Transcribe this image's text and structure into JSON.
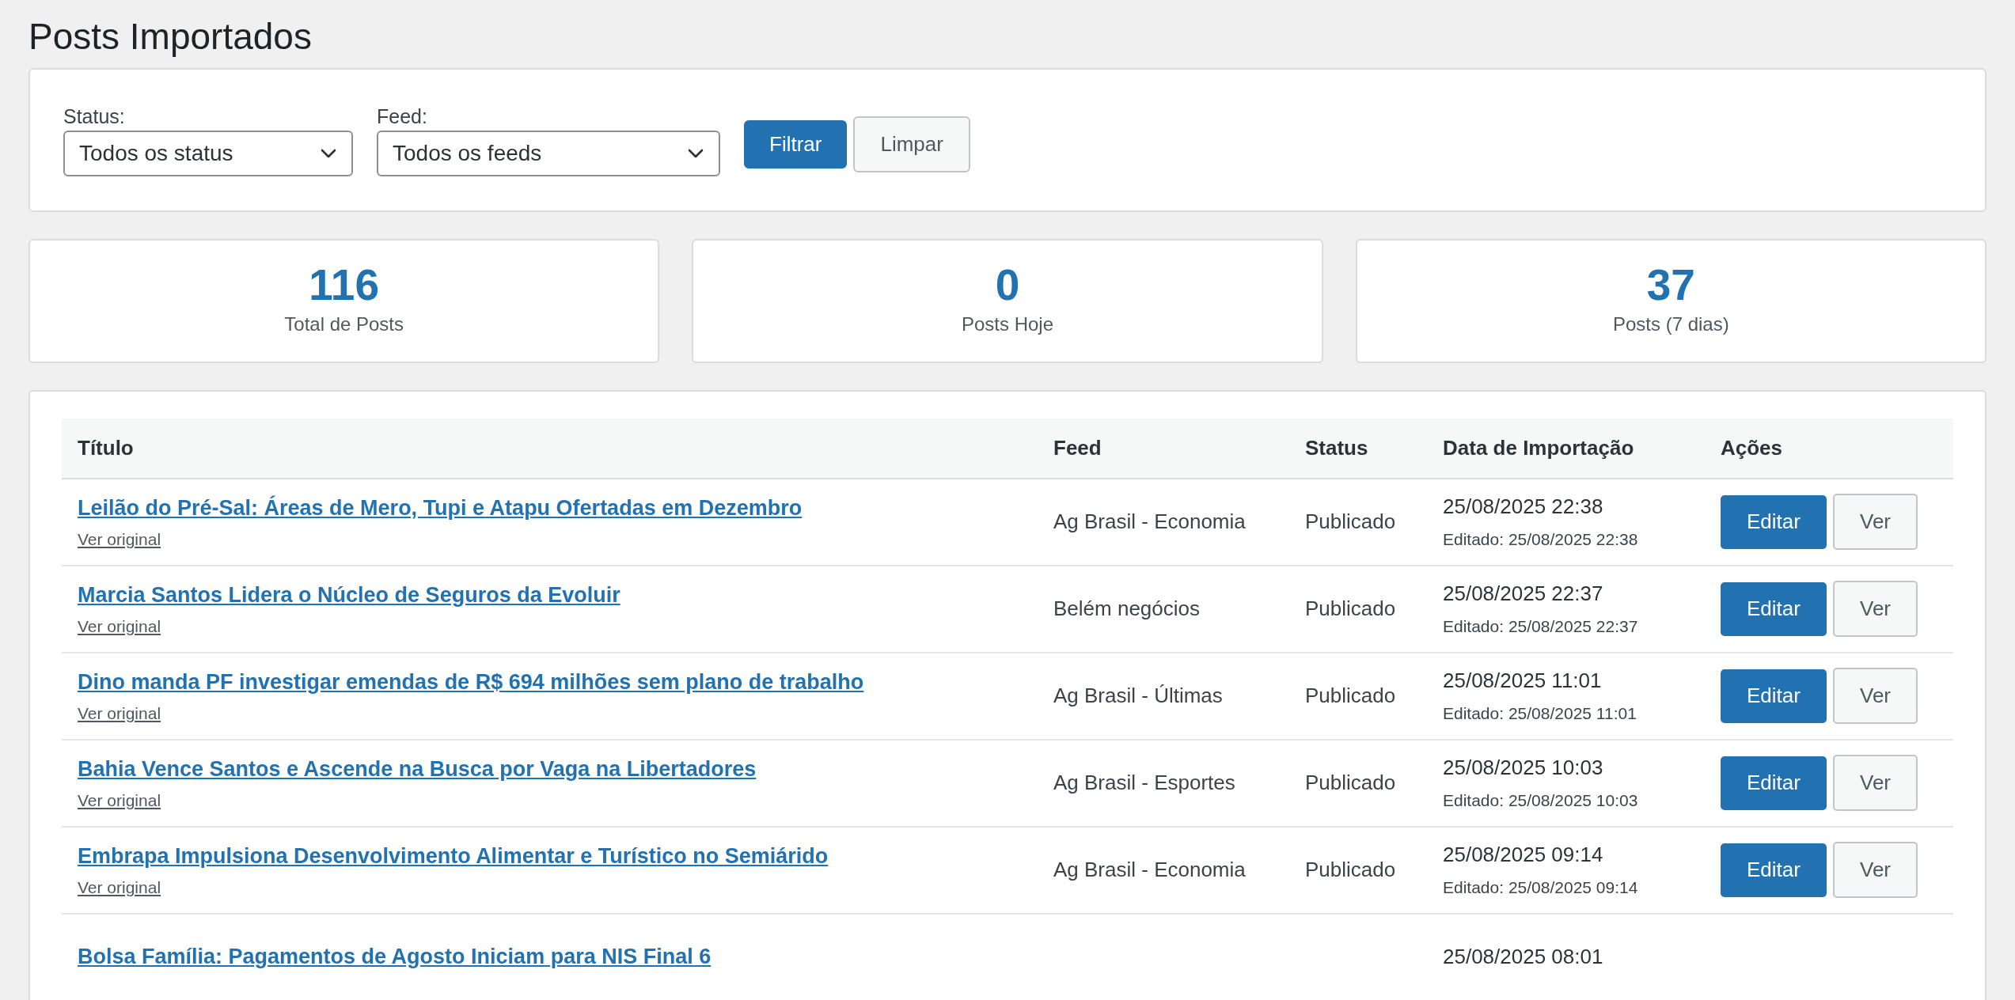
{
  "page": {
    "title": "Posts Importados"
  },
  "filters": {
    "status": {
      "label": "Status:",
      "value": "Todos os status"
    },
    "feed": {
      "label": "Feed:",
      "value": "Todos os feeds"
    },
    "buttons": [
      {
        "label": "Filtrar",
        "kind": "primary"
      },
      {
        "label": "Limpar",
        "kind": "secondary"
      }
    ]
  },
  "stats": [
    {
      "value": "116",
      "label": "Total de Posts"
    },
    {
      "value": "0",
      "label": "Posts Hoje"
    },
    {
      "value": "37",
      "label": "Posts (7 dias)"
    }
  ],
  "table": {
    "columns": [
      "Título",
      "Feed",
      "Status",
      "Data de Importação",
      "Ações"
    ],
    "rows": [
      {
        "title": "Leilão do Pré-Sal: Áreas de Mero, Tupi e Atapu Ofertadas em Dezembro",
        "link": "Ver original",
        "feed": "Ag Brasil - Economia",
        "status": "Publicado",
        "date": "25/08/2025 22:38",
        "edited": "Editado: 25/08/2025 22:38",
        "actions": [
          "Editar",
          "Ver"
        ]
      },
      {
        "title": "Marcia Santos Lidera o Núcleo de Seguros da Evoluir",
        "link": "Ver original",
        "feed": "Belém negócios",
        "status": "Publicado",
        "date": "25/08/2025 22:37",
        "edited": "Editado: 25/08/2025 22:37",
        "actions": [
          "Editar",
          "Ver"
        ]
      },
      {
        "title": "Dino manda PF investigar emendas de R$ 694 milhões sem plano de trabalho",
        "link": "Ver original",
        "feed": "Ag Brasil - Últimas",
        "status": "Publicado",
        "date": "25/08/2025 11:01",
        "edited": "Editado: 25/08/2025 11:01",
        "actions": [
          "Editar",
          "Ver"
        ]
      },
      {
        "title": "Bahia Vence Santos e Ascende na Busca por Vaga na Libertadores",
        "link": "Ver original",
        "feed": "Ag Brasil - Esportes",
        "status": "Publicado",
        "date": "25/08/2025 10:03",
        "edited": "Editado: 25/08/2025 10:03",
        "actions": [
          "Editar",
          "Ver"
        ]
      },
      {
        "title": "Embrapa Impulsiona Desenvolvimento Alimentar e Turístico no Semiárido",
        "link": "Ver original",
        "feed": "Ag Brasil - Economia",
        "status": "Publicado",
        "date": "25/08/2025 09:14",
        "edited": "Editado: 25/08/2025 09:14",
        "actions": [
          "Editar",
          "Ver"
        ]
      },
      {
        "title": "Bolsa Família: Pagamentos de Agosto Iniciam para NIS Final 6",
        "date": "25/08/2025 08:01"
      }
    ]
  }
}
